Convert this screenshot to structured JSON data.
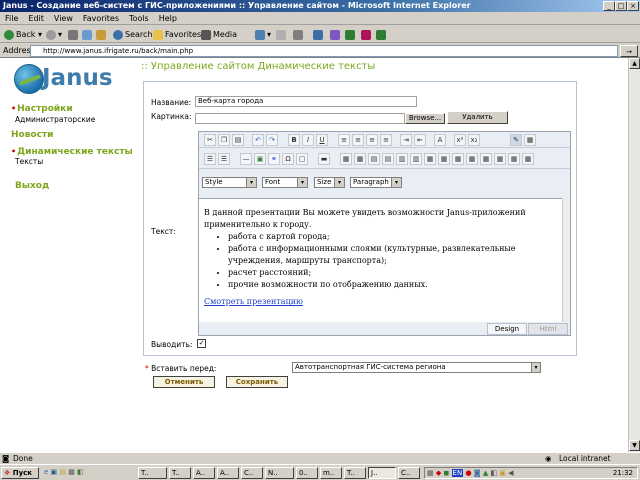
{
  "window": {
    "title": "Janus - Создание веб-систем с ГИС-приложениями :: Управление сайтом - Microsoft Internet Explorer"
  },
  "menu": [
    "File",
    "Edit",
    "View",
    "Favorites",
    "Tools",
    "Help"
  ],
  "toolbar": {
    "back": "Back",
    "search": "Search",
    "favorites": "Favorites",
    "media": "Media"
  },
  "address": {
    "label": "Address",
    "url": "http://www.janus.ifrigate.ru/back/main.php"
  },
  "logo": {
    "text": "Janus"
  },
  "nav": [
    {
      "label": "Настройки",
      "sub": "Администраторские"
    },
    {
      "label": "Новости",
      "sub": ""
    },
    {
      "label": "Динамические тексты",
      "sub": "Тексты"
    },
    {
      "label": "Выход",
      "sub": ""
    }
  ],
  "page": {
    "title": ":: Управление сайтом Динамические тексты"
  },
  "form": {
    "name_label": "Название:",
    "name_value": "Веб-карта города",
    "image_label": "Картинка:",
    "browse": "Browse...",
    "delete": "Удалить",
    "text_label": "Текст:",
    "show_label": "Выводить:",
    "insert_label": "Вставить перед:",
    "insert_value": "Автотранспортная ГИС-система региона",
    "cancel": "Отменить",
    "save": "Сохранить"
  },
  "editor": {
    "style": "Style",
    "font": "Font",
    "size": "Size",
    "format": "Paragraph",
    "intro": "В данной презентации Вы можете увидеть возможности Janus-приложений применительно к городу.",
    "items": [
      "работа с картой города;",
      "работа с информационными слоями (культурные, развлекательные учреждения, маршруты транспорта);",
      "расчет расстояний;",
      "прочие возможности по отображению данных."
    ],
    "link": "Смотреть презентацию",
    "tab_design": "Design",
    "tab_html": "Html"
  },
  "status": {
    "left": "Done",
    "zone": "Local intranet"
  },
  "taskbar": {
    "start": "Пуск",
    "tasks": [
      "T..",
      "T..",
      "A..",
      "A..",
      "C..",
      "N..",
      "0..",
      "m..",
      "T..",
      "J..",
      "C.."
    ],
    "lang": "EN",
    "clock": "21:32"
  }
}
